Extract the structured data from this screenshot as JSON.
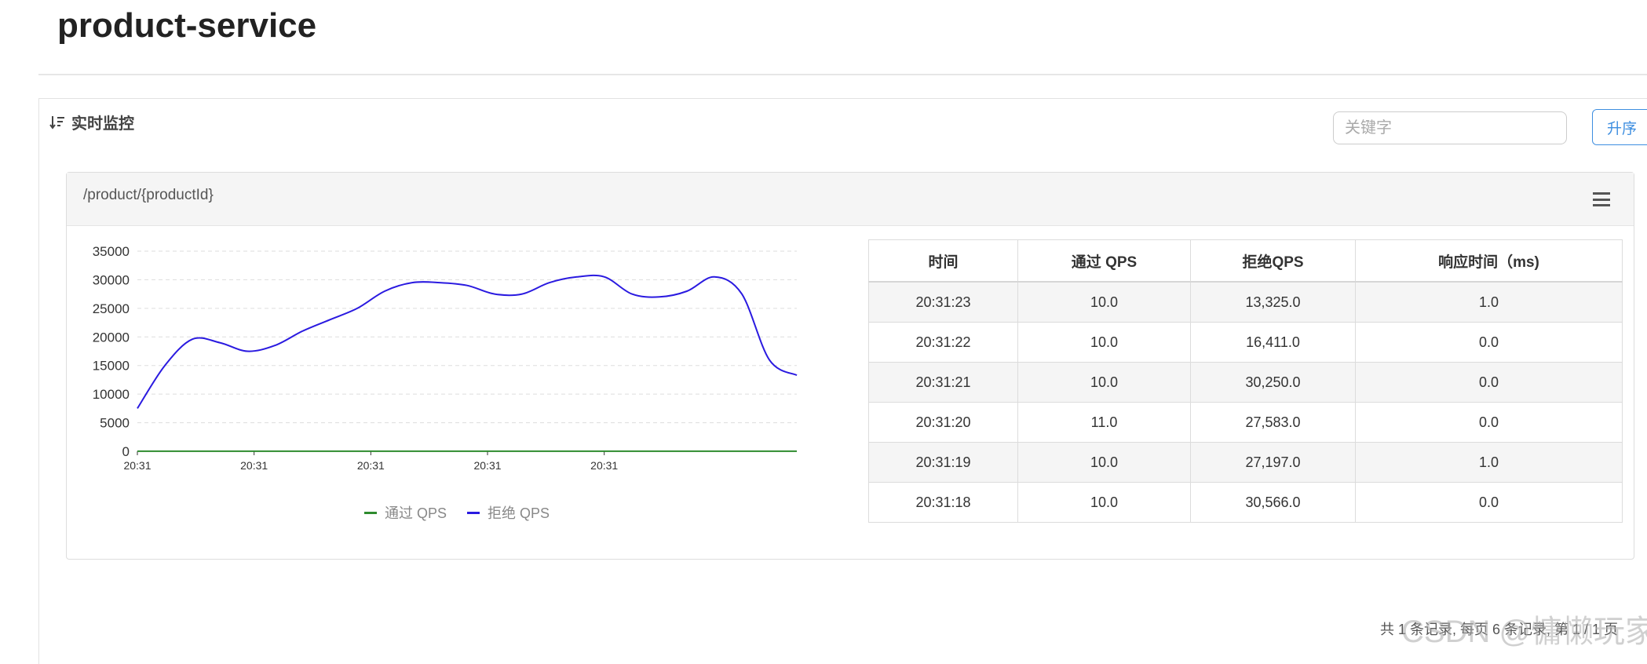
{
  "header": {
    "title": "product-service"
  },
  "panel": {
    "title": "实时监控",
    "search": {
      "placeholder": "关键字",
      "value": ""
    },
    "sort_button": "升序"
  },
  "card": {
    "resource": "/product/{productId}",
    "chart_data": {
      "type": "line",
      "x": [
        "20:31",
        "20:31",
        "20:31",
        "20:31",
        "20:31"
      ],
      "ylim": [
        0,
        35000
      ],
      "y_ticks": [
        "35000",
        "30000",
        "25000",
        "20000",
        "15000",
        "10000",
        "5000",
        "0"
      ],
      "grid": true,
      "legend_position": "bottom",
      "series": [
        {
          "name": "通过 QPS",
          "color": "#2e8b2e",
          "values": [
            10,
            10,
            10,
            10,
            10,
            10,
            10,
            10,
            10,
            10,
            10,
            10,
            10,
            10,
            10,
            10,
            10,
            10,
            10,
            10,
            10,
            10,
            10,
            11,
            10
          ]
        },
        {
          "name": "拒绝 QPS",
          "color": "#2a1ae0",
          "values": [
            7500,
            15000,
            19600,
            19000,
            17500,
            18500,
            21000,
            23000,
            25000,
            28000,
            29500,
            29500,
            29000,
            27500,
            27500,
            29500,
            30500,
            30500,
            27500,
            27000,
            28000,
            30500,
            27500,
            16000,
            13300
          ]
        }
      ]
    },
    "table": {
      "headers": [
        "时间",
        "通过 QPS",
        "拒绝QPS",
        "响应时间（ms)"
      ],
      "rows": [
        [
          "20:31:23",
          "10.0",
          "13,325.0",
          "1.0"
        ],
        [
          "20:31:22",
          "10.0",
          "16,411.0",
          "0.0"
        ],
        [
          "20:31:21",
          "10.0",
          "30,250.0",
          "0.0"
        ],
        [
          "20:31:20",
          "11.0",
          "27,583.0",
          "0.0"
        ],
        [
          "20:31:19",
          "10.0",
          "27,197.0",
          "1.0"
        ],
        [
          "20:31:18",
          "10.0",
          "30,566.0",
          "0.0"
        ]
      ]
    }
  },
  "footer": {
    "pagination": "共 1 条记录, 每页 6 条记录, 第 1 / 1 页"
  },
  "watermark": "CSDN @慵懒玩家"
}
